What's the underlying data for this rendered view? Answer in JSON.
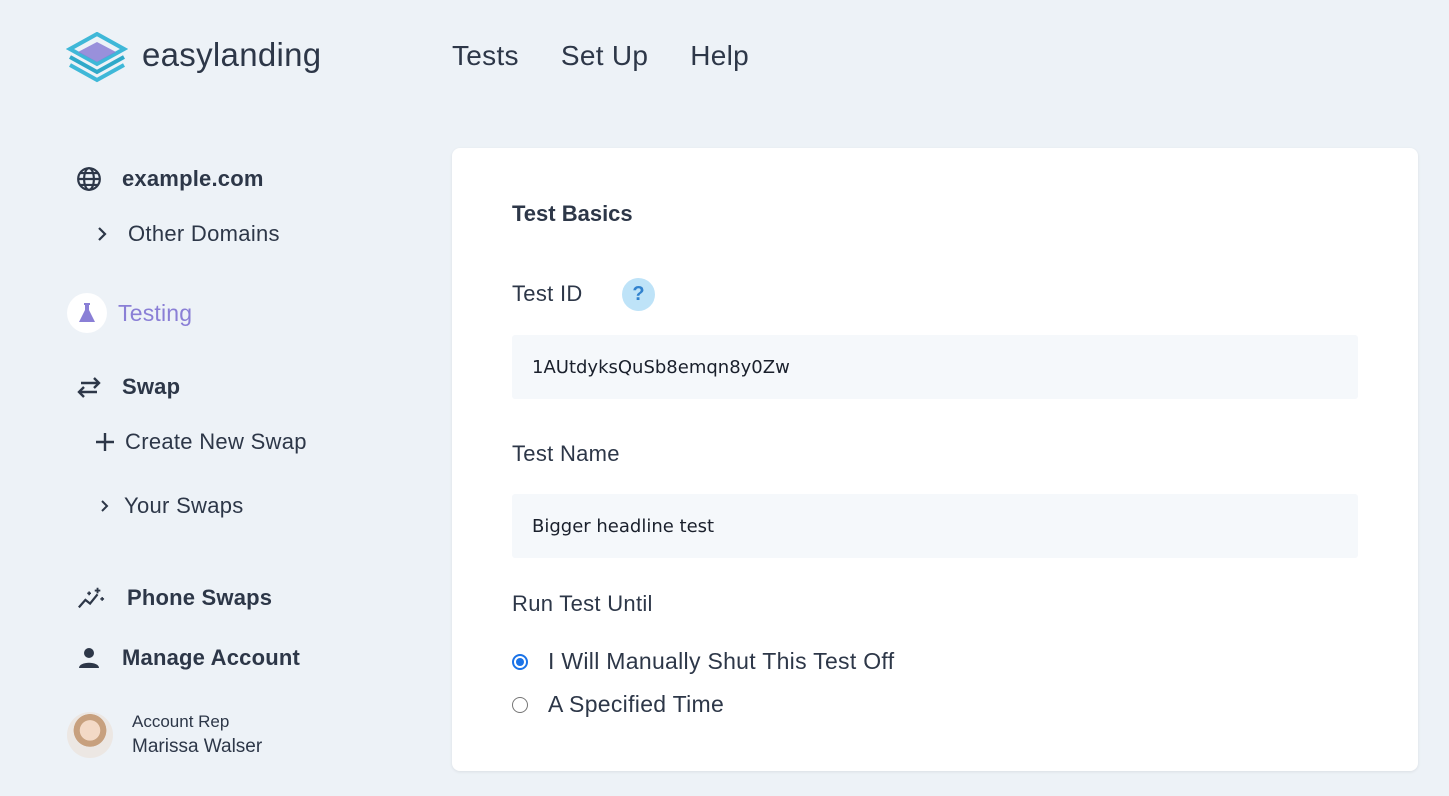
{
  "brand": {
    "name": "easylanding"
  },
  "nav": {
    "items": [
      "Tests",
      "Set Up",
      "Help"
    ]
  },
  "sidebar": {
    "domain": "example.com",
    "other_domains": "Other Domains",
    "testing": "Testing",
    "swap": "Swap",
    "create_swap": "Create New Swap",
    "your_swaps": "Your Swaps",
    "phone_swaps": "Phone Swaps",
    "manage_account": "Manage Account",
    "rep_title": "Account Rep",
    "rep_name": "Marissa Walser"
  },
  "card": {
    "title": "Test Basics",
    "test_id_label": "Test ID",
    "help": "?",
    "test_id_value": "1AUtdyksQuSb8emqn8y0Zw",
    "test_name_label": "Test Name",
    "test_name_value": "Bigger headline test",
    "run_until_label": "Run Test Until",
    "options": [
      "I Will Manually Shut This Test Off",
      "A Specified Time"
    ],
    "selected_option": "I Will Manually Shut This Test Off"
  },
  "colors": {
    "accent": "#8a7fd6",
    "help_bg": "#bee3f8",
    "radio": "#1a73e8",
    "background": "#edf2f7"
  }
}
